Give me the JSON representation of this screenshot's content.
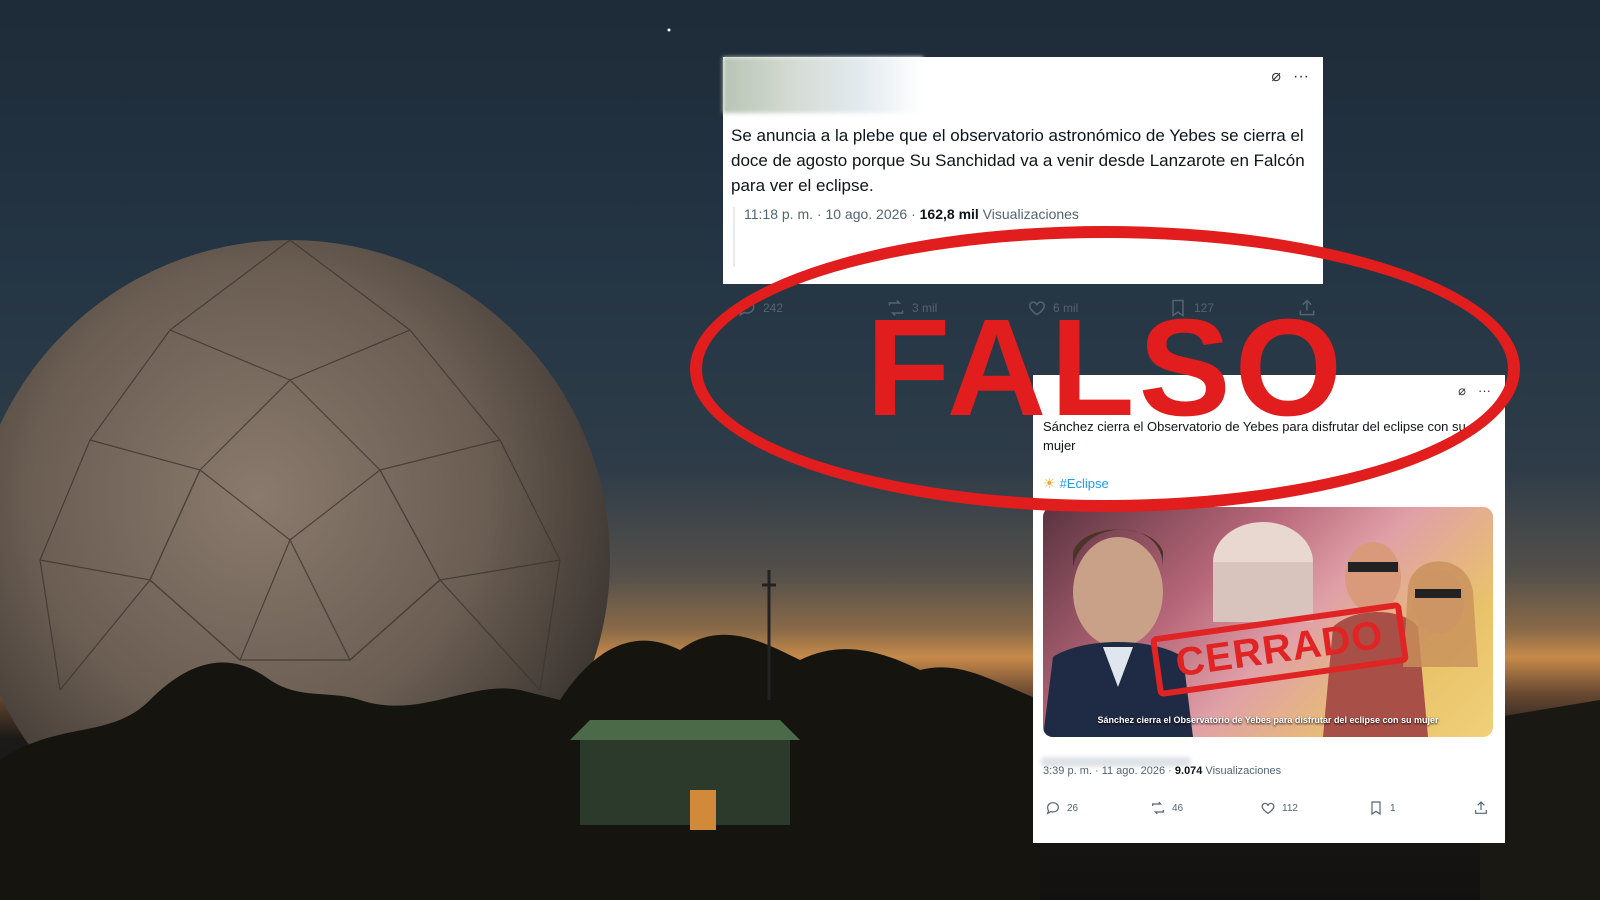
{
  "verdict": {
    "label": "FALSO",
    "color": "#e11d1d"
  },
  "tweet1": {
    "text": "Se anuncia a la plebe que el observatorio astronómico de Yebes se cierra el doce de agosto porque Su Sanchidad va a venir desde Lanzarote en Falcón para ver el eclipse.",
    "time": "11:18 p. m. · 10 ago. 2026 · ",
    "views_count": "162,8 mil",
    "views_label": " Visualizaciones",
    "replies": "242",
    "reposts": "3 mil",
    "likes": "6 mil",
    "bookmarks": "127"
  },
  "tweet2": {
    "text": "Sánchez cierra el Observatorio de Yebes para disfrutar del eclipse con su mujer",
    "hashtag": "#Eclipse",
    "media_stamp": "CERRADO",
    "media_caption": "Sánchez cierra el Observatorio de Yebes para disfrutar del eclipse con su mujer",
    "time": "3:39 p. m. · 11 ago. 2026 · ",
    "views_count": "9.074",
    "views_label": " Visualizaciones",
    "replies": "26",
    "reposts": "46",
    "likes": "112",
    "bookmarks": "1"
  },
  "icons": {
    "grok": "grok-icon",
    "more": "more-icon",
    "reply": "reply-icon",
    "repost": "repost-icon",
    "like": "like-icon",
    "bookmark": "bookmark-icon",
    "share": "share-icon"
  }
}
